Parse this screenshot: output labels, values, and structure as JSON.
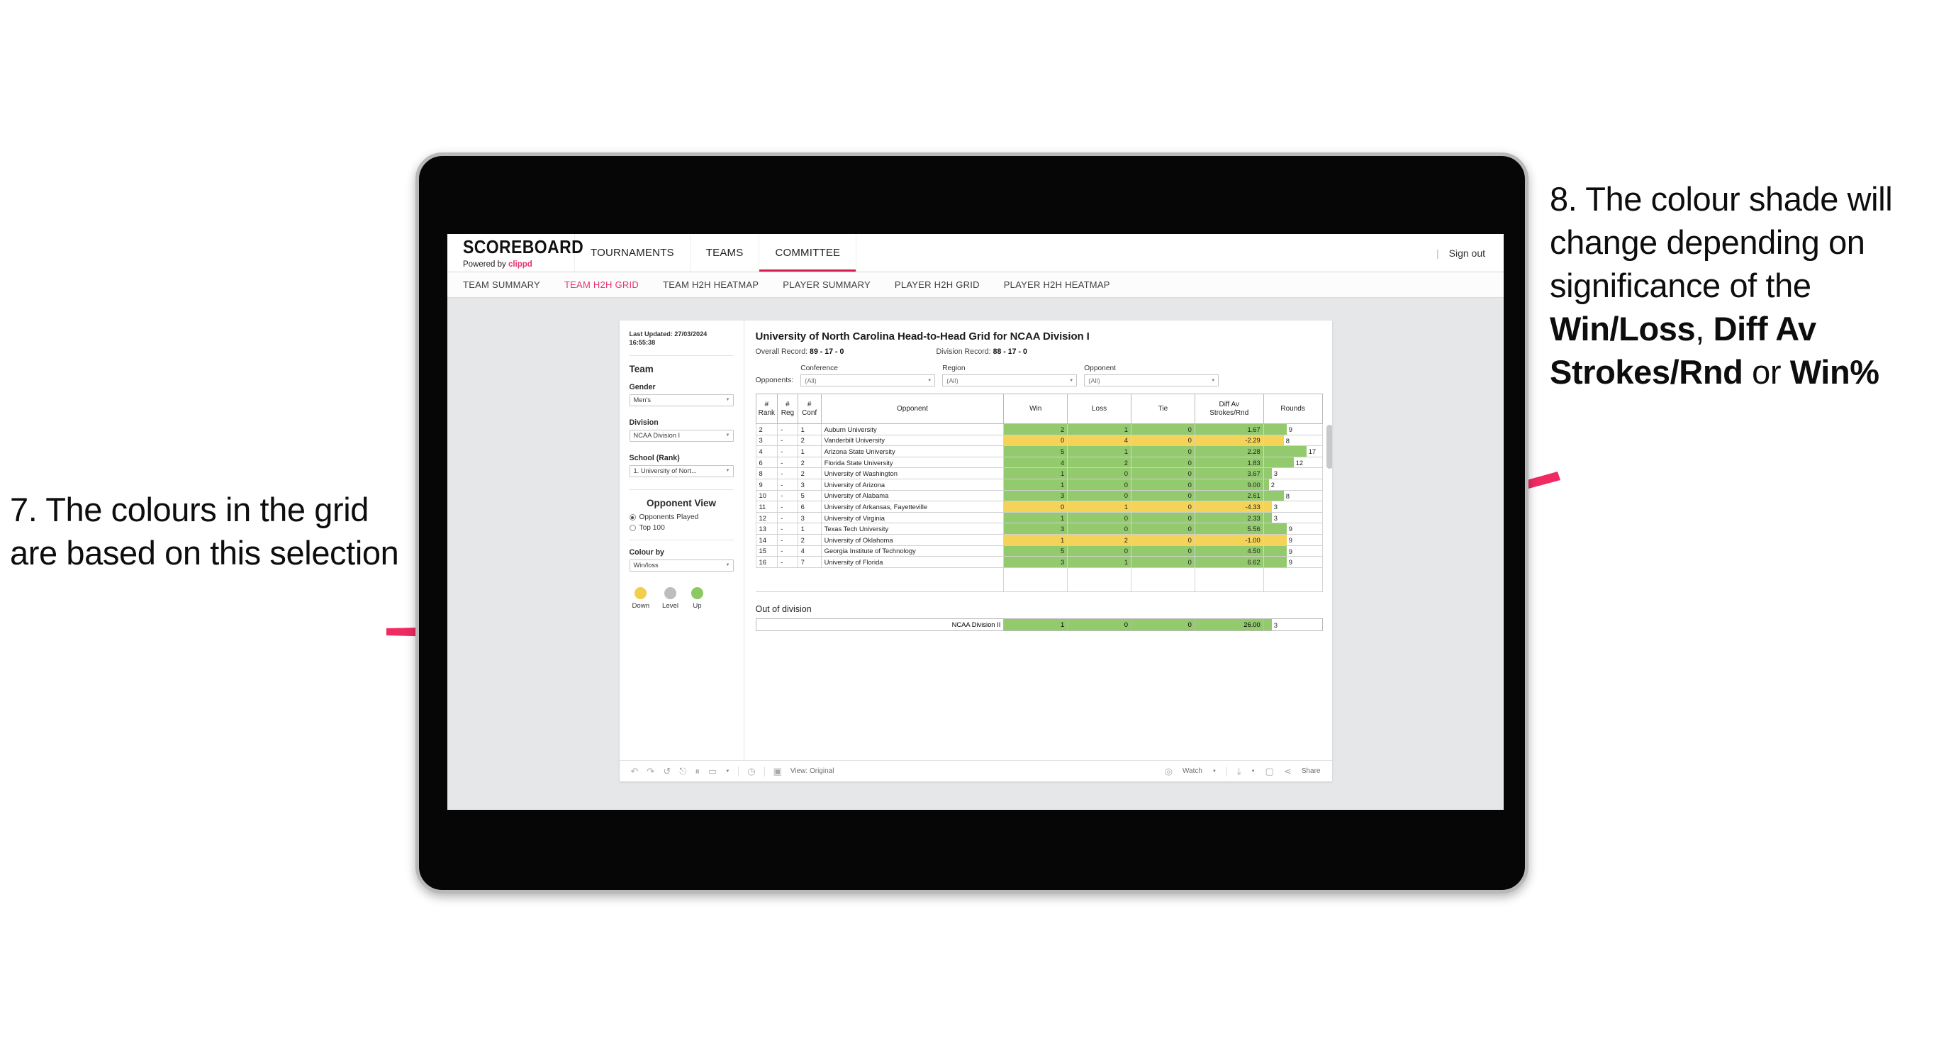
{
  "annotations": {
    "left": "7. The colours in the grid are based on this selection",
    "right_prefix": "8. The colour shade will change depending on significance of the ",
    "right_bold1": "Win/Loss",
    "right_mid1": ", ",
    "right_bold2": "Diff Av Strokes/Rnd",
    "right_mid2": " or ",
    "right_bold3": "Win%",
    "arrow_color": "#ef2b62"
  },
  "topnav": {
    "brand_title": "SCOREBOARD",
    "brand_sub_prefix": "Powered by ",
    "brand_sub_brand": "clippd",
    "items": [
      {
        "label": "TOURNAMENTS",
        "active": false
      },
      {
        "label": "TEAMS",
        "active": false
      },
      {
        "label": "COMMITTEE",
        "active": true
      }
    ],
    "divider": "|",
    "signout": "Sign out"
  },
  "subnav": {
    "items": [
      {
        "label": "TEAM SUMMARY",
        "active": false
      },
      {
        "label": "TEAM H2H GRID",
        "active": true
      },
      {
        "label": "TEAM H2H HEATMAP",
        "active": false
      },
      {
        "label": "PLAYER SUMMARY",
        "active": false
      },
      {
        "label": "PLAYER H2H GRID",
        "active": false
      },
      {
        "label": "PLAYER H2H HEATMAP",
        "active": false
      }
    ]
  },
  "sidebar": {
    "last_updated": "Last Updated: 27/03/2024 16:55:38",
    "team_section": "Team",
    "gender_label": "Gender",
    "gender_value": "Men's",
    "division_label": "Division",
    "division_value": "NCAA Division I",
    "school_label": "School (Rank)",
    "school_value": "1. University of Nort...",
    "opponent_view_title": "Opponent View",
    "opponent_view_options": [
      {
        "label": "Opponents Played",
        "selected": true
      },
      {
        "label": "Top 100",
        "selected": false
      }
    ],
    "colour_by_label": "Colour by",
    "colour_by_value": "Win/loss",
    "legend": [
      {
        "label": "Down",
        "color": "#f2cf4a"
      },
      {
        "label": "Level",
        "color": "#bdbdbd"
      },
      {
        "label": "Up",
        "color": "#8dc963"
      }
    ]
  },
  "main": {
    "title": "University of North Carolina Head-to-Head Grid for NCAA Division I",
    "overall_record_label": "Overall Record: ",
    "overall_record_value": "89 - 17 - 0",
    "division_record_label": "Division Record: ",
    "division_record_value": "88 - 17 - 0",
    "opponents_label": "Opponents:",
    "filters": [
      {
        "label": "Conference",
        "value": "(All)"
      },
      {
        "label": "Region",
        "value": "(All)"
      },
      {
        "label": "Opponent",
        "value": "(All)"
      }
    ],
    "out_of_division_title": "Out of division"
  },
  "chart_data": {
    "type": "table",
    "title": "University of North Carolina Head-to-Head Grid for NCAA Division I",
    "columns": [
      "# Rank",
      "# Reg",
      "# Conf",
      "Opponent",
      "Win",
      "Loss",
      "Tie",
      "Diff Av Strokes/Rnd",
      "Rounds"
    ],
    "rounds_axis_max": 20,
    "color_rules": {
      "up": "#93ca6e",
      "down": "#f5d358",
      "level": "#bdbdbd"
    },
    "rows": [
      {
        "rank": "2",
        "reg": "-",
        "conf": "1",
        "opponent": "Auburn University",
        "win": "2",
        "loss": "1",
        "tie": "0",
        "diff": "1.67",
        "rounds": "9",
        "rounds_val": 9,
        "state": "up"
      },
      {
        "rank": "3",
        "reg": "-",
        "conf": "2",
        "opponent": "Vanderbilt University",
        "win": "0",
        "loss": "4",
        "tie": "0",
        "diff": "-2.29",
        "rounds": "8",
        "rounds_val": 8,
        "state": "down"
      },
      {
        "rank": "4",
        "reg": "-",
        "conf": "1",
        "opponent": "Arizona State University",
        "win": "5",
        "loss": "1",
        "tie": "0",
        "diff": "2.28",
        "rounds": "17",
        "rounds_val": 17,
        "state": "up"
      },
      {
        "rank": "6",
        "reg": "-",
        "conf": "2",
        "opponent": "Florida State University",
        "win": "4",
        "loss": "2",
        "tie": "0",
        "diff": "1.83",
        "rounds": "12",
        "rounds_val": 12,
        "state": "up"
      },
      {
        "rank": "8",
        "reg": "-",
        "conf": "2",
        "opponent": "University of Washington",
        "win": "1",
        "loss": "0",
        "tie": "0",
        "diff": "3.67",
        "rounds": "3",
        "rounds_val": 3,
        "state": "up"
      },
      {
        "rank": "9",
        "reg": "-",
        "conf": "3",
        "opponent": "University of Arizona",
        "win": "1",
        "loss": "0",
        "tie": "0",
        "diff": "9.00",
        "rounds": "2",
        "rounds_val": 2,
        "state": "up"
      },
      {
        "rank": "10",
        "reg": "-",
        "conf": "5",
        "opponent": "University of Alabama",
        "win": "3",
        "loss": "0",
        "tie": "0",
        "diff": "2.61",
        "rounds": "8",
        "rounds_val": 8,
        "state": "up"
      },
      {
        "rank": "11",
        "reg": "-",
        "conf": "6",
        "opponent": "University of Arkansas, Fayetteville",
        "win": "0",
        "loss": "1",
        "tie": "0",
        "diff": "-4.33",
        "rounds": "3",
        "rounds_val": 3,
        "state": "down"
      },
      {
        "rank": "12",
        "reg": "-",
        "conf": "3",
        "opponent": "University of Virginia",
        "win": "1",
        "loss": "0",
        "tie": "0",
        "diff": "2.33",
        "rounds": "3",
        "rounds_val": 3,
        "state": "up"
      },
      {
        "rank": "13",
        "reg": "-",
        "conf": "1",
        "opponent": "Texas Tech University",
        "win": "3",
        "loss": "0",
        "tie": "0",
        "diff": "5.56",
        "rounds": "9",
        "rounds_val": 9,
        "state": "up"
      },
      {
        "rank": "14",
        "reg": "-",
        "conf": "2",
        "opponent": "University of Oklahoma",
        "win": "1",
        "loss": "2",
        "tie": "0",
        "diff": "-1.00",
        "rounds": "9",
        "rounds_val": 9,
        "state": "down"
      },
      {
        "rank": "15",
        "reg": "-",
        "conf": "4",
        "opponent": "Georgia Institute of Technology",
        "win": "5",
        "loss": "0",
        "tie": "0",
        "diff": "4.50",
        "rounds": "9",
        "rounds_val": 9,
        "state": "up"
      },
      {
        "rank": "16",
        "reg": "-",
        "conf": "7",
        "opponent": "University of Florida",
        "win": "3",
        "loss": "1",
        "tie": "0",
        "diff": "6.62",
        "rounds": "9",
        "rounds_val": 9,
        "state": "up"
      }
    ],
    "out_of_division": [
      {
        "opponent": "NCAA Division II",
        "win": "1",
        "loss": "0",
        "tie": "0",
        "diff": "26.00",
        "rounds": "3",
        "rounds_val": 3,
        "state": "up"
      }
    ]
  },
  "toolbar": {
    "icons": [
      "undo-icon",
      "redo-icon",
      "revert-icon",
      "refresh-icon",
      "pause-icon",
      "share-alt-icon",
      "caret-icon"
    ],
    "clock_icon": "clock-icon",
    "view_label": "View: Original",
    "watch_label": "Watch",
    "share_label": "Share"
  }
}
